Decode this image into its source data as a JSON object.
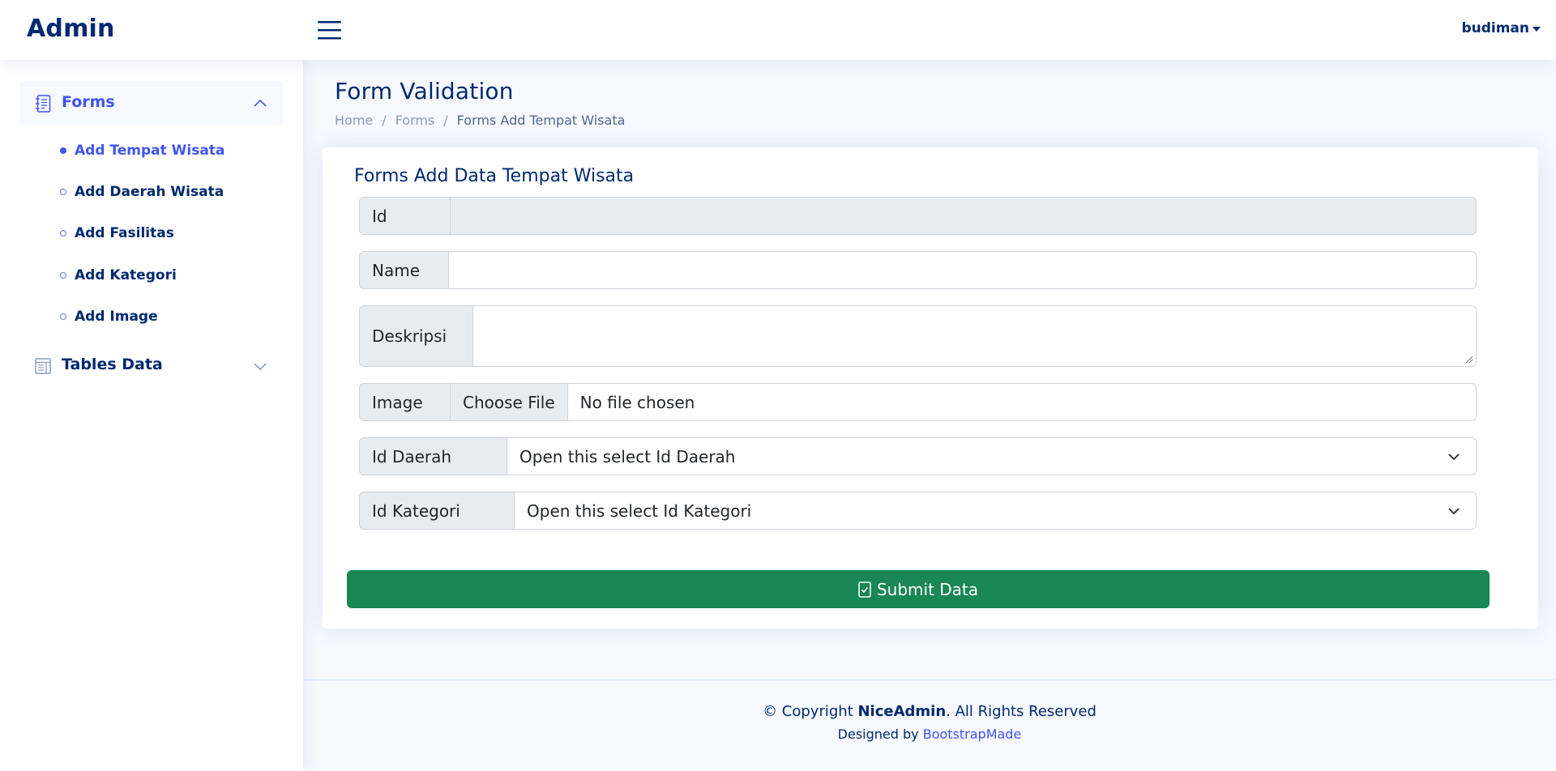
{
  "header": {
    "logo": "Admin",
    "user_name": "budiman"
  },
  "sidebar": {
    "forms_label": "Forms",
    "forms_items": [
      {
        "label": "Add Tempat Wisata",
        "active": true
      },
      {
        "label": "Add Daerah Wisata",
        "active": false
      },
      {
        "label": "Add Fasilitas",
        "active": false
      },
      {
        "label": "Add Kategori",
        "active": false
      },
      {
        "label": "Add Image",
        "active": false
      }
    ],
    "tables_label": "Tables Data"
  },
  "page": {
    "title": "Form Validation",
    "breadcrumb": [
      "Home",
      "Forms",
      "Forms Add Tempat Wisata"
    ]
  },
  "form": {
    "title": "Forms Add Data Tempat Wisata",
    "id_label": "Id",
    "id_value": "",
    "name_label": "Name",
    "name_value": "",
    "deskripsi_label": "Deskripsi",
    "deskripsi_value": "",
    "image_label": "Image",
    "file_button": "Choose File",
    "file_status": "No file chosen",
    "daerah_label": "Id Daerah",
    "daerah_selected": "Open this select Id Daerah",
    "kategori_label": "Id Kategori",
    "kategori_selected": "Open this select Id Kategori",
    "submit_label": "Submit Data"
  },
  "footer": {
    "copyright_prefix": "© Copyright ",
    "brand": "NiceAdmin",
    "copyright_suffix": ". All Rights Reserved",
    "designed_by": "Designed by ",
    "designer": "BootstrapMade"
  },
  "colors": {
    "primary": "#4154f1",
    "navy": "#012970",
    "success": "#198754",
    "background": "#f6f9ff"
  }
}
